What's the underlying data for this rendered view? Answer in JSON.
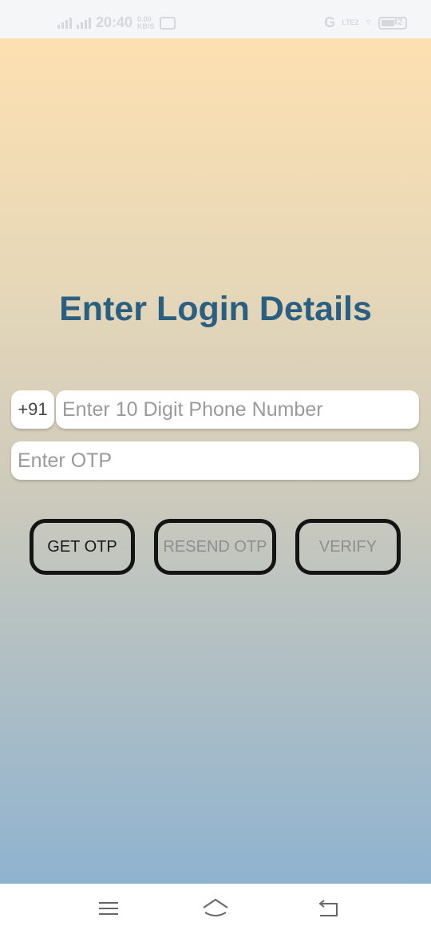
{
  "status_bar": {
    "time": "20:40",
    "speed_value": "0.00",
    "speed_unit": "KB/S",
    "network_type": "LTE2",
    "battery_level": "42"
  },
  "login": {
    "title": "Enter Login Details",
    "country_code": "+91",
    "phone_placeholder": "Enter 10 Digit Phone Number",
    "otp_placeholder": "Enter OTP"
  },
  "buttons": {
    "get_otp": "GET OTP",
    "resend_otp": "RESEND OTP",
    "verify": "VERIFY"
  },
  "nav_bar": {
    "icons": [
      "menu-icon",
      "home-icon",
      "back-icon"
    ]
  },
  "colors": {
    "title": "#2a5f82",
    "gradient_top": "#fde0b1",
    "gradient_bottom": "#8fb3d0",
    "button_border": "#141414",
    "disabled_text": "#8e8e8e"
  }
}
